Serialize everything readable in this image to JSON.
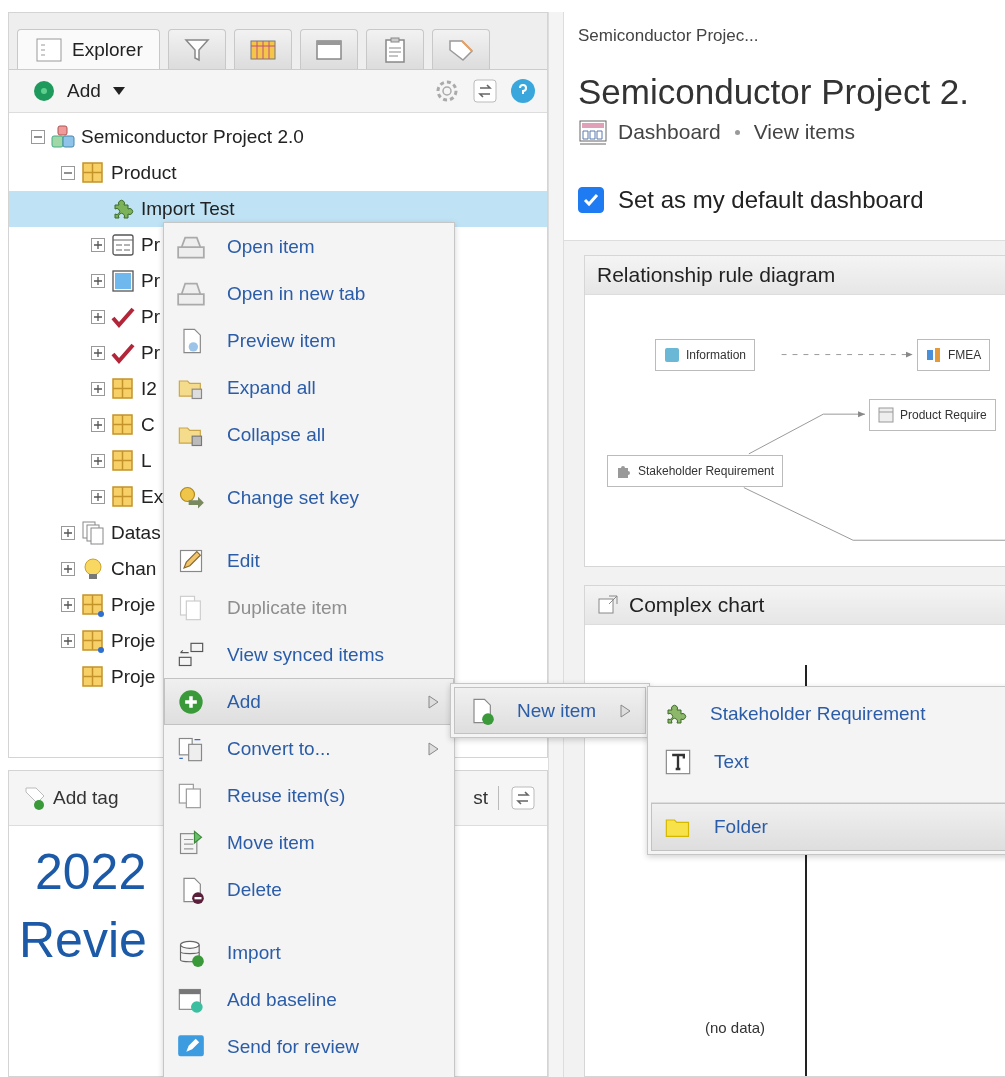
{
  "explorer": {
    "tabs": [
      {
        "label": "Explorer",
        "selected": true
      },
      {
        "selected": false
      },
      {
        "selected": false
      },
      {
        "selected": false
      },
      {
        "selected": false
      },
      {
        "selected": false
      }
    ],
    "toolbar": {
      "add_label": "Add"
    },
    "tree": [
      {
        "label": "Semiconductor Project 2.0",
        "kind": "project",
        "expanded": true,
        "selected": false,
        "children": [
          {
            "label": "Product",
            "kind": "folder",
            "expanded": true,
            "selected": false,
            "children": [
              {
                "label": "Import Test",
                "kind": "puzzle",
                "selected": true
              },
              {
                "label": "Pr",
                "kind": "form",
                "expanded": false,
                "selected": false
              },
              {
                "label": "Pr",
                "kind": "image",
                "expanded": false,
                "selected": false
              },
              {
                "label": "Pr",
                "kind": "check",
                "expanded": false,
                "selected": false
              },
              {
                "label": "Pr",
                "kind": "check",
                "expanded": false,
                "selected": false
              },
              {
                "label": "I2",
                "kind": "folder",
                "expanded": false,
                "selected": false
              },
              {
                "label": "C",
                "kind": "folder",
                "expanded": false,
                "selected": false
              },
              {
                "label": "L",
                "kind": "folder",
                "expanded": false,
                "selected": false
              },
              {
                "label": "Ex",
                "kind": "folder",
                "expanded": false,
                "selected": false
              }
            ]
          },
          {
            "label": "Datas",
            "kind": "dataset",
            "expanded": false,
            "selected": false
          },
          {
            "label": "Chan",
            "kind": "bulb",
            "expanded": false,
            "selected": false
          },
          {
            "label": "Proje",
            "kind": "synced",
            "expanded": false,
            "selected": false
          },
          {
            "label": "Proje",
            "kind": "synced",
            "expanded": false,
            "selected": false
          },
          {
            "label": "Proje",
            "kind": "folder",
            "selected": false
          }
        ]
      }
    ]
  },
  "tags_panel": {
    "add_tag": "Add tag",
    "cut_label": "st",
    "headline": [
      "2022",
      "Revie"
    ]
  },
  "content": {
    "breadcrumb": "Semiconductor Projec...",
    "title": "Semiconductor Project 2.",
    "links": [
      "Dashboard",
      "View items"
    ],
    "default_dashboard": {
      "label": "Set as my default dashboard",
      "checked": true
    },
    "widgets": [
      {
        "kind": "diagram",
        "title": "Relationship rule diagram",
        "nodes": [
          {
            "label": "Information"
          },
          {
            "label": "FMEA"
          },
          {
            "label": "Product Require"
          },
          {
            "label": "Stakeholder Requirement"
          }
        ]
      },
      {
        "kind": "chart",
        "title": "Complex chart",
        "empty_text": "(no data)"
      }
    ]
  },
  "context_menu": {
    "groups": [
      [
        {
          "label": "Open item",
          "selected": false,
          "disabled": false
        },
        {
          "label": "Open in new tab",
          "selected": false,
          "disabled": false
        },
        {
          "label": "Preview item",
          "selected": false,
          "disabled": false
        },
        {
          "label": "Expand all",
          "selected": false,
          "disabled": false
        },
        {
          "label": "Collapse all",
          "selected": false,
          "disabled": false
        }
      ],
      [
        {
          "label": "Change set key",
          "selected": false,
          "disabled": false
        }
      ],
      [
        {
          "label": "Edit",
          "selected": false,
          "disabled": false
        },
        {
          "label": "Duplicate item",
          "selected": false,
          "disabled": true
        },
        {
          "label": "View synced items",
          "selected": false,
          "disabled": false
        },
        {
          "label": "Add",
          "selected": true,
          "disabled": false,
          "submenu": true
        },
        {
          "label": "Convert to...",
          "selected": false,
          "disabled": false,
          "submenu": true
        },
        {
          "label": "Reuse item(s)",
          "selected": false,
          "disabled": false
        },
        {
          "label": "Move item",
          "selected": false,
          "disabled": false
        },
        {
          "label": "Delete",
          "selected": false,
          "disabled": false
        }
      ],
      [
        {
          "label": "Import",
          "selected": false,
          "disabled": false
        },
        {
          "label": "Add baseline",
          "selected": false,
          "disabled": false
        },
        {
          "label": "Send for review",
          "selected": false,
          "disabled": false
        }
      ]
    ]
  },
  "add_submenu": {
    "items": [
      {
        "label": "New item",
        "selected": true,
        "submenu": true
      }
    ]
  },
  "new_item_submenu": {
    "groups": [
      [
        {
          "label": "Stakeholder Requirement",
          "selected": false
        },
        {
          "label": "Text",
          "selected": false
        }
      ],
      [
        {
          "label": "Folder",
          "selected": true
        }
      ]
    ]
  }
}
